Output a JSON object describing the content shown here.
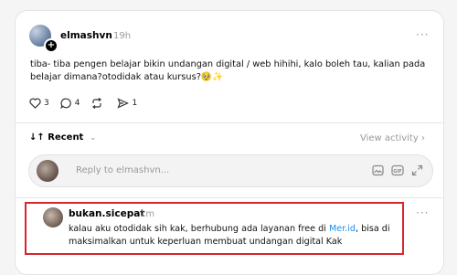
{
  "post": {
    "username": "elmashvn",
    "time": "19h",
    "more": "···",
    "text": "tiba- tiba pengen belajar bikin undangan digital / web hihihi, kalo boleh tau, kalian pada belajar dimana?otodidak atau kursus?🥹✨",
    "likes": "3",
    "comments": "4",
    "shares": "1"
  },
  "sort": {
    "label": "Recent",
    "arrows": "↓↑",
    "chevron": "⌄",
    "view_activity": "View activity ›"
  },
  "reply": {
    "placeholder": "Reply to elmashvn..."
  },
  "comment": {
    "username": "bukan.sicepat",
    "time": "1m",
    "more": "···",
    "text_before": "kalau aku otodidak sih kak, berhubung ada layanan free di ",
    "link": "Mer.id",
    "text_after": ", bisa di maksimalkan untuk keperluan membuat undangan digital Kak",
    "highlight_color": "#d7262d"
  },
  "colors": {
    "link": "#1d8cf0",
    "muted": "#999999"
  }
}
